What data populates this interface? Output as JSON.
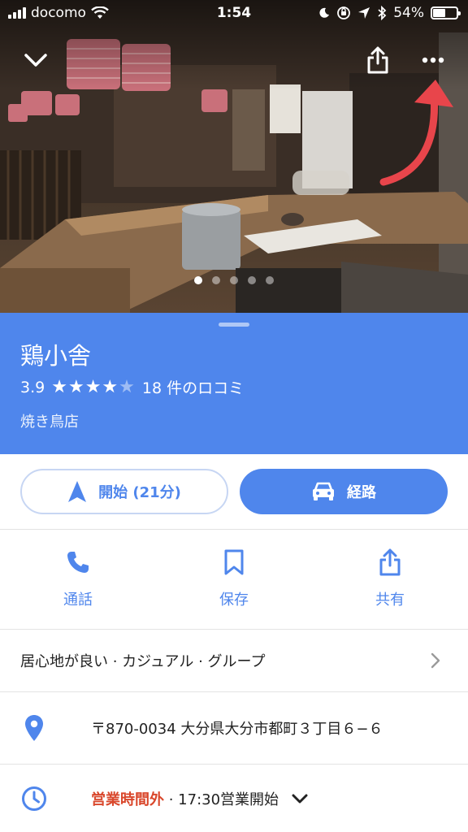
{
  "status_bar": {
    "carrier": "docomo",
    "time": "1:54",
    "battery": "54%",
    "battery_fraction": 0.54
  },
  "gallery": {
    "image_count": 5,
    "active_index": 0
  },
  "place": {
    "name": "鶏小舎",
    "rating": "3.9",
    "stars_filled": 4,
    "stars_total": 5,
    "reviews": "18 件のロコミ",
    "category": "焼き鳥店"
  },
  "actions": {
    "start_label": "開始 (21分)",
    "route_label": "経路"
  },
  "quick": [
    {
      "label": "通話",
      "icon": "phone-icon"
    },
    {
      "label": "保存",
      "icon": "bookmark-icon"
    },
    {
      "label": "共有",
      "icon": "share-icon"
    }
  ],
  "details": {
    "tags": "居心地が良い · カジュアル · グループ",
    "address": "〒870-0034 大分県大分市都町３丁目６−６",
    "hours_status": "営業時間外",
    "hours_next": " · 17:30営業開始"
  },
  "colors": {
    "brand_blue": "#4f86ec",
    "closed_red": "#d9472b",
    "annotation_arrow": "#e8454b"
  }
}
